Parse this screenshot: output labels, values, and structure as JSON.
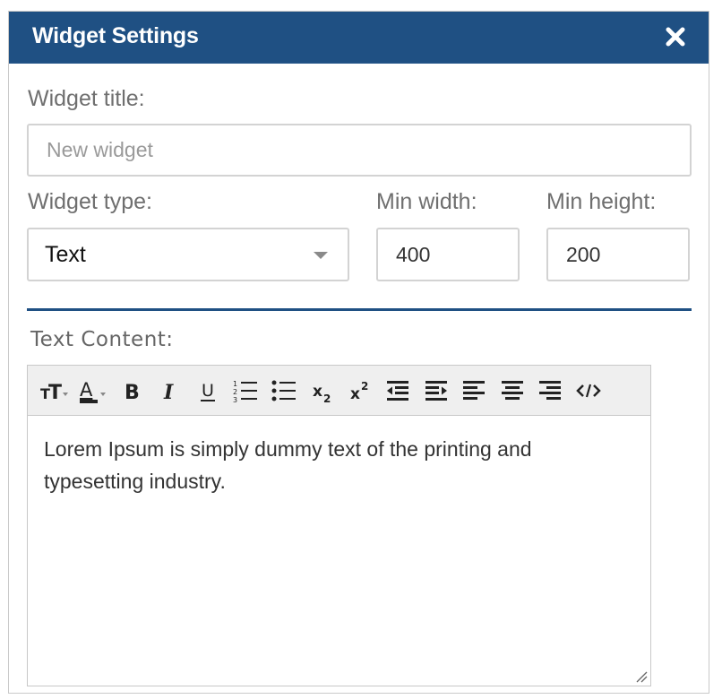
{
  "dialog": {
    "title": "Widget Settings",
    "close_icon": "close-icon"
  },
  "form": {
    "widget_title_label": "Widget title:",
    "widget_title_placeholder": "New widget",
    "widget_title_value": "",
    "widget_type_label": "Widget type:",
    "widget_type_value": "Text",
    "min_width_label": "Min width:",
    "min_width_value": "400",
    "min_height_label": "Min height:",
    "min_height_value": "200"
  },
  "editor": {
    "label": "Text Content:",
    "content": "Lorem Ipsum is simply dummy text of the printing and typesetting industry.",
    "toolbar": [
      {
        "name": "font-size-icon"
      },
      {
        "name": "font-color-icon"
      },
      {
        "name": "bold-icon"
      },
      {
        "name": "italic-icon"
      },
      {
        "name": "underline-icon"
      },
      {
        "name": "ordered-list-icon"
      },
      {
        "name": "unordered-list-icon"
      },
      {
        "name": "subscript-icon"
      },
      {
        "name": "superscript-icon"
      },
      {
        "name": "outdent-icon"
      },
      {
        "name": "indent-icon"
      },
      {
        "name": "align-left-icon"
      },
      {
        "name": "align-center-icon"
      },
      {
        "name": "align-right-icon"
      },
      {
        "name": "code-view-icon"
      }
    ]
  },
  "colors": {
    "header": "#1f5083",
    "accent": "#1f5083",
    "label": "#6f6f6f"
  }
}
